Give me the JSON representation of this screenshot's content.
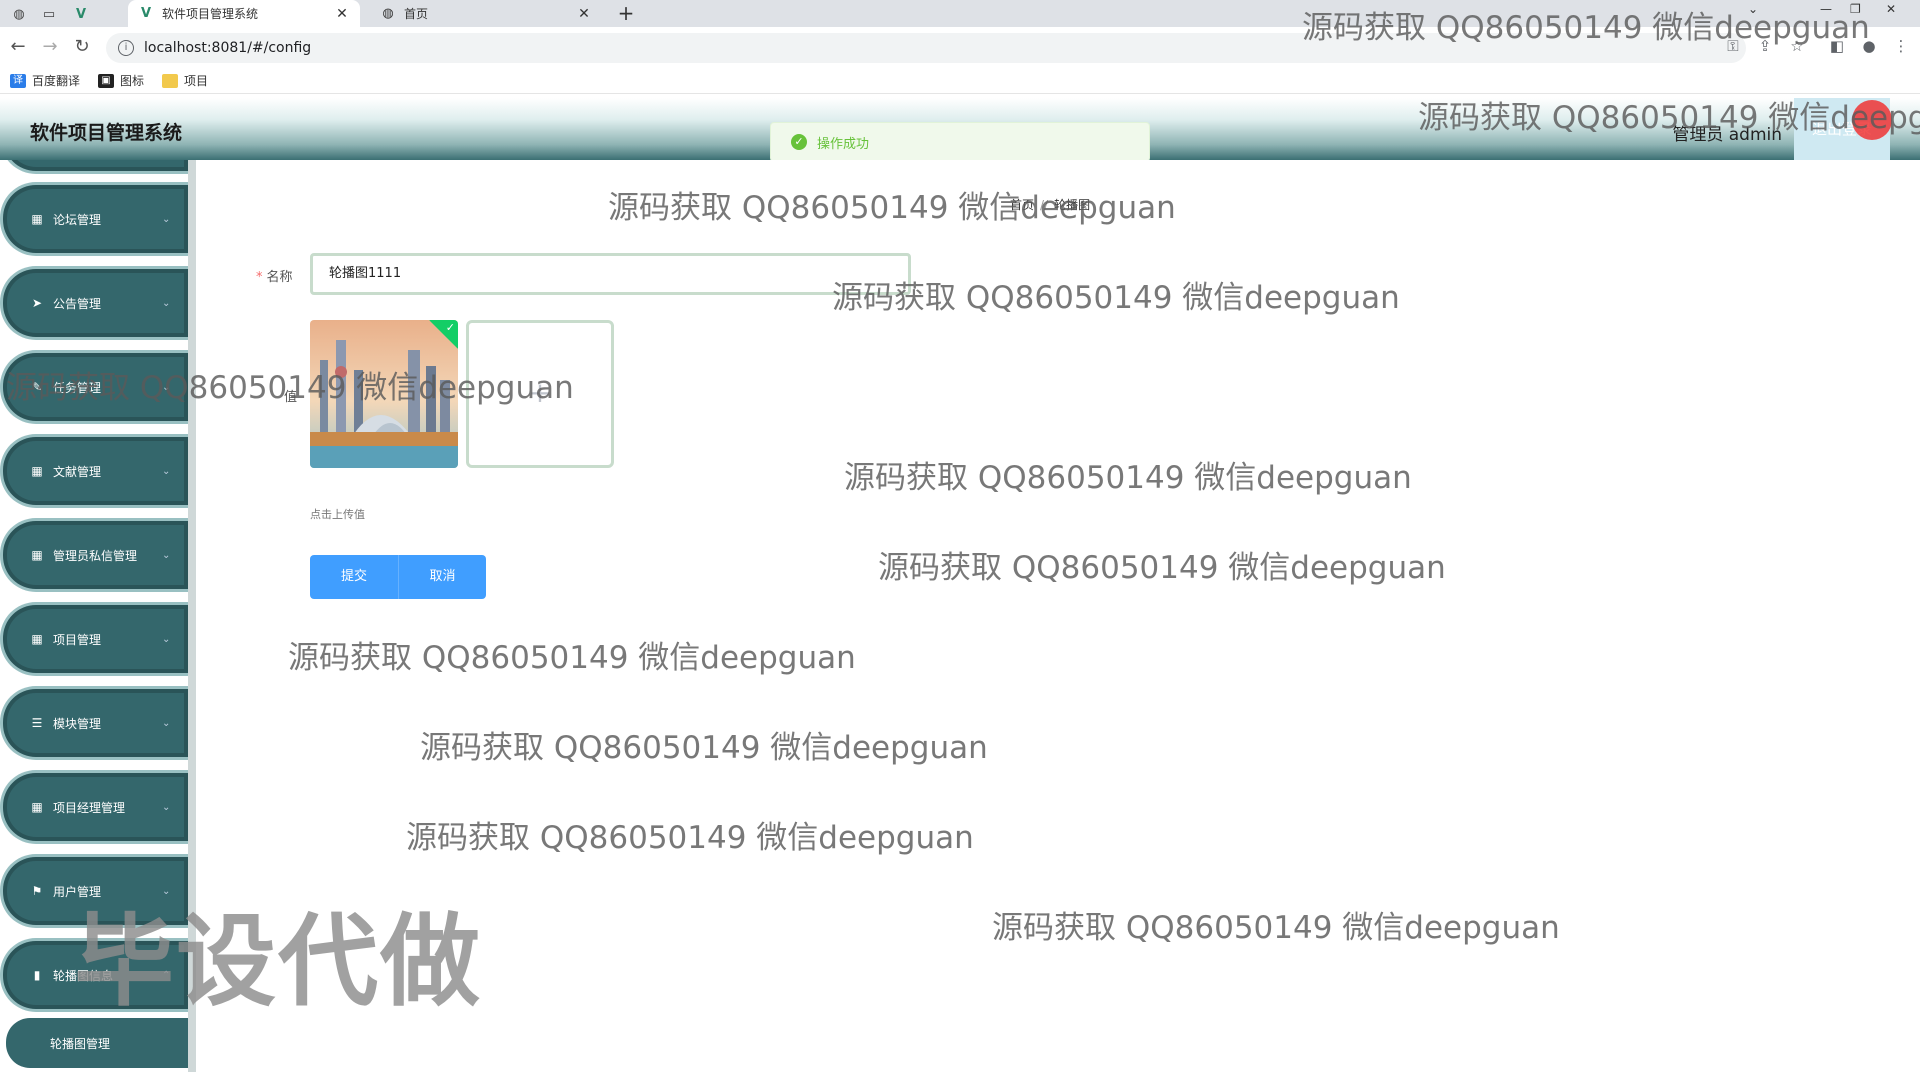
{
  "browser": {
    "tabs": [
      {
        "title": "软件项目管理系统",
        "active": true
      },
      {
        "title": "首页",
        "active": false
      }
    ],
    "url": "localhost:8081/#/config",
    "bookmarks": [
      "百度翻译",
      "图标",
      "项目"
    ]
  },
  "header": {
    "title": "软件项目管理系统",
    "admin_label": "管理员 admin",
    "logout_label": "退出登录"
  },
  "toast": {
    "message": "操作成功"
  },
  "sidebar": {
    "items": [
      {
        "label": "论坛管理",
        "icon": "grid-icon"
      },
      {
        "label": "公告管理",
        "icon": "send-icon"
      },
      {
        "label": "任务管理",
        "icon": "edit-icon"
      },
      {
        "label": "文献管理",
        "icon": "grid-icon"
      },
      {
        "label": "管理员私信管理",
        "icon": "grid-icon"
      },
      {
        "label": "项目管理",
        "icon": "grid-icon"
      },
      {
        "label": "模块管理",
        "icon": "sliders-icon"
      },
      {
        "label": "项目经理管理",
        "icon": "grid-icon"
      },
      {
        "label": "用户管理",
        "icon": "flag-icon"
      },
      {
        "label": "轮播图信息",
        "icon": "chart-icon"
      }
    ],
    "sub_item": "轮播图管理"
  },
  "breadcrumb": {
    "home": "首页",
    "separator": "//",
    "current": "轮播图"
  },
  "form": {
    "name_label": "名称",
    "name_value": "轮播图1111",
    "value_label": "值",
    "upload_hint": "点击上传值",
    "submit_label": "提交",
    "cancel_label": "取消"
  },
  "watermarks": {
    "text": "源码获取 QQ86050149 微信deepguan",
    "big_text": "毕设代做"
  }
}
